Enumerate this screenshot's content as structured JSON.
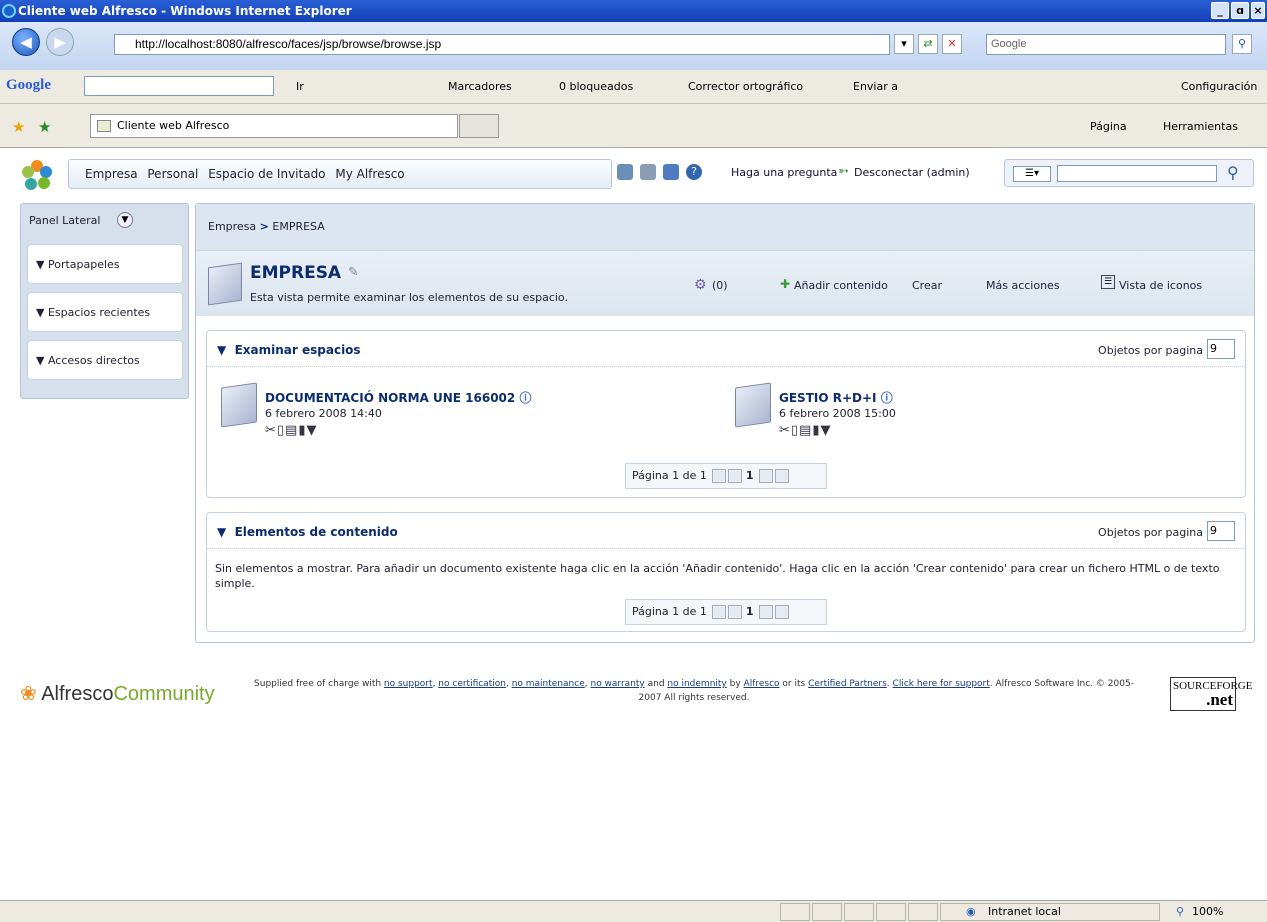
{
  "window": {
    "title": "Cliente web Alfresco - Windows Internet Explorer",
    "controls": [
      "_",
      "ɑ",
      "×"
    ]
  },
  "address": {
    "url": "http://localhost:8080/alfresco/faces/jsp/browse/browse.jsp",
    "search_placeholder": "Google"
  },
  "google_toolbar": {
    "logo": "Google",
    "go": "Ir",
    "bookmarks": "Marcadores",
    "blocked": "0 bloqueados",
    "spellcheck": "Corrector ortográfico",
    "send": "Enviar a",
    "settings": "Configuración"
  },
  "tab": {
    "label": "Cliente web Alfresco",
    "page_menu": "Página",
    "tools_menu": "Herramientas"
  },
  "header": {
    "nav": [
      "Empresa",
      "Personal",
      "Espacio de Invitado",
      "My Alfresco"
    ],
    "help": "Haga una pregunta",
    "logout": "Desconectar (admin)"
  },
  "sidebar": {
    "title": "Panel Lateral",
    "items": [
      "Portapapeles",
      "Espacios recientes",
      "Accesos directos"
    ]
  },
  "breadcrumb": {
    "root": "Empresa",
    "sep": ">",
    "current": "EMPRESA"
  },
  "space": {
    "title": "EMPRESA",
    "description": "Esta vista permite examinar los elementos de su espacio.",
    "count": "(0)",
    "add_content": "Añadir contenido",
    "create": "Crear",
    "more_actions": "Más acciones",
    "view": "Vista de iconos"
  },
  "browse_spaces": {
    "title": "Examinar espacios",
    "per_page_label": "Objetos por pagina",
    "per_page_value": "9",
    "items": [
      {
        "name": "DOCUMENTACIÓ NORMA UNE 166002",
        "date": "6 febrero 2008 14:40"
      },
      {
        "name": "GESTIO R+D+I",
        "date": "6 febrero 2008 15:00"
      }
    ],
    "pager": {
      "label": "Página 1 de 1",
      "current": "1"
    }
  },
  "content_items": {
    "title": "Elementos de contenido",
    "per_page_label": "Objetos por pagina",
    "per_page_value": "9",
    "empty_message": "Sin elementos a mostrar. Para añadir un documento existente haga clic en la acción 'Añadir contenido'. Haga clic en la acción 'Crear contenido' para crear un fichero HTML o de texto simple.",
    "pager": {
      "label": "Página 1 de 1",
      "current": "1"
    }
  },
  "footer": {
    "brand_a": "Alfresco",
    "brand_b": "Community",
    "t1": "Supplied free of charge with ",
    "l1": "no support",
    "t2": ", ",
    "l2": "no certification",
    "t3": ", ",
    "l3": "no maintenance",
    "t4": ", ",
    "l4": "no warranty",
    "t5": " and ",
    "l5": "no indemnity",
    "t6": " by ",
    "l6": "Alfresco",
    "t7": " or its ",
    "l7": "Certified Partners",
    "t8": ". ",
    "l8": "Click here for support",
    "t9": ". Alfresco Software Inc. © 2005-2007 All rights reserved.",
    "sf_top": "SOURCEFORGE",
    "sf_bottom": ".net"
  },
  "status": {
    "zone": "Intranet local",
    "zoom": "100%"
  }
}
